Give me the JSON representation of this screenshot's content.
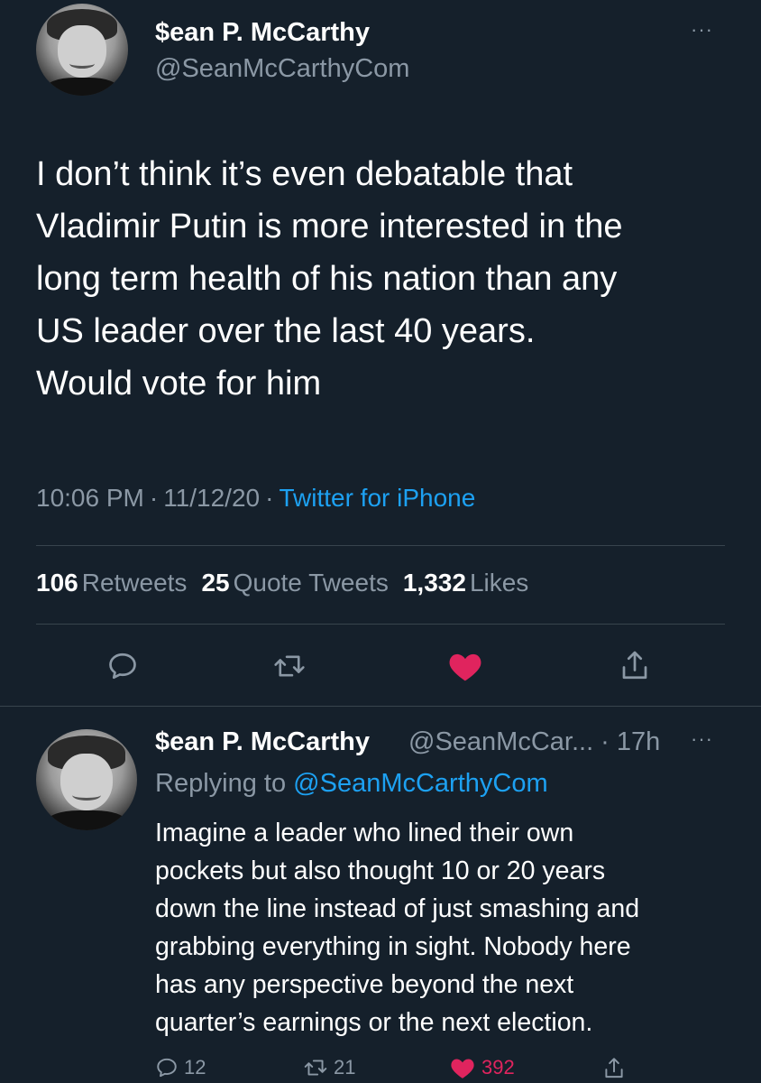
{
  "main_tweet": {
    "author_name": "$ean P. McCarthy",
    "author_handle": "@SeanMcCarthyCom",
    "text": "I don’t think it’s even debatable that\nVladimir Putin is more interested in the\nlong term health of his nation than any\nUS leader over the last 40 years.\nWould vote for him",
    "time": "10:06 PM",
    "date": "11/12/20",
    "separator": "·",
    "source": "Twitter for iPhone",
    "stats": {
      "retweets_count": "106",
      "retweets_label": "Retweets",
      "quotes_count": "25",
      "quotes_label": "Quote Tweets",
      "likes_count": "1,332",
      "likes_label": "Likes"
    },
    "more_icon": "···"
  },
  "reply_tweet": {
    "author_name": "$ean P. McCarthy",
    "author_handle_time": "@SeanMcCar... · 17h",
    "replying_prefix": "Replying to",
    "replying_to": "@SeanMcCarthyCom",
    "text": "Imagine a leader who lined their own\npockets but also thought 10 or 20 years\ndown the line instead of just smashing and\ngrabbing everything in sight. Nobody here\nhas any perspective beyond the next\nquarter’s earnings or the next election.",
    "reply_count": "12",
    "retweet_count": "21",
    "like_count": "392",
    "more_icon": "···"
  },
  "colors": {
    "background": "#15202b",
    "secondary_text": "#8b98a5",
    "link": "#1da1f2",
    "like": "#e0245e",
    "divider": "#38444d"
  },
  "icons": [
    "reply-icon",
    "retweet-icon",
    "like-icon",
    "share-icon",
    "more-icon"
  ]
}
